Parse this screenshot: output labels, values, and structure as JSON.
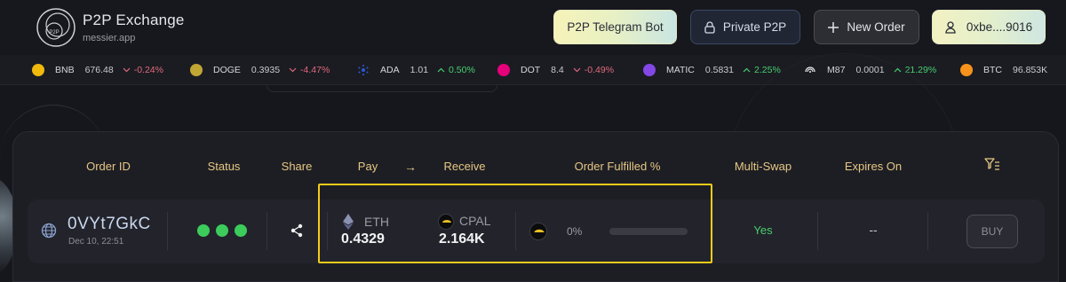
{
  "brand": {
    "title": "P2P Exchange",
    "subtitle": "messier.app",
    "logo_text": "P2P"
  },
  "header": {
    "telegram_label": "P2P Telegram Bot",
    "private_label": "Private P2P",
    "new_order_label": "New Order",
    "wallet_label": "0xbe....9016"
  },
  "ticker": [
    {
      "symbol": "BNB",
      "price": "676.48",
      "change": "-0.24%",
      "direction": "down",
      "color": "#f0b90b",
      "icon": "bnb-icon"
    },
    {
      "symbol": "DOGE",
      "price": "0.3935",
      "change": "-4.47%",
      "direction": "down",
      "color": "#c2a633",
      "icon": "doge-icon"
    },
    {
      "symbol": "ADA",
      "price": "1.01",
      "change": "0.50%",
      "direction": "up",
      "color": "#2a5ada",
      "icon": "ada-icon"
    },
    {
      "symbol": "DOT",
      "price": "8.4",
      "change": "-0.49%",
      "direction": "down",
      "color": "#e6007a",
      "icon": "dot-icon"
    },
    {
      "symbol": "MATIC",
      "price": "0.5831",
      "change": "2.25%",
      "direction": "up",
      "color": "#8247e5",
      "icon": "matic-icon"
    },
    {
      "symbol": "M87",
      "price": "0.0001",
      "change": "21.29%",
      "direction": "up",
      "color": "#e8e8ea",
      "icon": "m87-icon"
    },
    {
      "symbol": "BTC",
      "price": "96.853K",
      "change": "",
      "direction": "up",
      "color": "#f7931a",
      "icon": "btc-icon"
    }
  ],
  "table": {
    "headers": {
      "order_id": "Order ID",
      "status": "Status",
      "share": "Share",
      "pay": "Pay",
      "arrow": "→",
      "receive": "Receive",
      "fulfilled": "Order Fulfilled %",
      "multiswap": "Multi-Swap",
      "expires": "Expires On"
    },
    "row": {
      "order_id": "0VYt7GkC",
      "date": "Dec 10, 22:51",
      "pay_symbol": "ETH",
      "pay_amount": "0.4329",
      "receive_symbol": "CPAL",
      "receive_amount": "2.164K",
      "fulfilled_pct": "0%",
      "fulfilled_fraction": 0,
      "multiswap": "Yes",
      "expires": "--",
      "buy_label": "BUY"
    }
  },
  "colors": {
    "accent_gold": "#e7c783",
    "status_green": "#3ccc5c",
    "highlight": "#f2cc1b"
  }
}
